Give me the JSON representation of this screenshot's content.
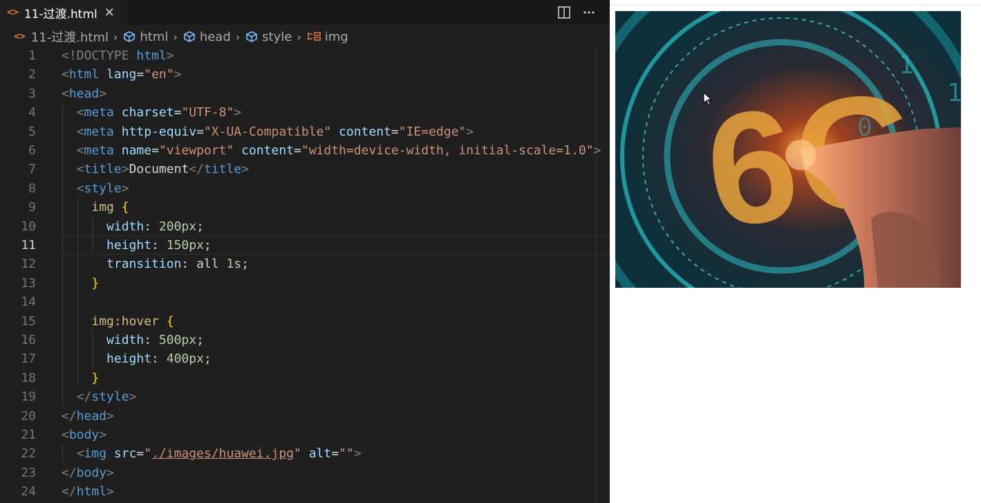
{
  "tab": {
    "icon": "<>",
    "title": "11-过渡.html",
    "close": "✕"
  },
  "breadcrumbs": [
    {
      "label": "11-过渡.html",
      "icon": "html-file-icon"
    },
    {
      "label": "html",
      "icon": "element-cube-icon"
    },
    {
      "label": "head",
      "icon": "element-cube-icon"
    },
    {
      "label": "style",
      "icon": "element-cube-icon"
    },
    {
      "label": "img",
      "icon": "css-rule-icon"
    }
  ],
  "code": {
    "active_line": 11,
    "lines": [
      {
        "n": "1",
        "t": [
          [
            "punc",
            "<!DOCTYPE "
          ],
          [
            "tag",
            "html"
          ],
          [
            "punc",
            ">"
          ]
        ]
      },
      {
        "n": "2",
        "t": [
          [
            "punc",
            "<"
          ],
          [
            "tag",
            "html"
          ],
          [
            "text",
            " "
          ],
          [
            "attr",
            "lang"
          ],
          [
            "text",
            "="
          ],
          [
            "str",
            "\"en\""
          ],
          [
            "punc",
            ">"
          ]
        ]
      },
      {
        "n": "3",
        "t": [
          [
            "punc",
            "<"
          ],
          [
            "tag",
            "head"
          ],
          [
            "punc",
            ">"
          ]
        ]
      },
      {
        "n": "4",
        "t": [
          [
            "text",
            "  "
          ],
          [
            "punc",
            "<"
          ],
          [
            "tag",
            "meta"
          ],
          [
            "text",
            " "
          ],
          [
            "attr",
            "charset"
          ],
          [
            "text",
            "="
          ],
          [
            "str",
            "\"UTF-8\""
          ],
          [
            "punc",
            ">"
          ]
        ]
      },
      {
        "n": "5",
        "t": [
          [
            "text",
            "  "
          ],
          [
            "punc",
            "<"
          ],
          [
            "tag",
            "meta"
          ],
          [
            "text",
            " "
          ],
          [
            "attr",
            "http-equiv"
          ],
          [
            "text",
            "="
          ],
          [
            "str",
            "\"X-UA-Compatible\""
          ],
          [
            "text",
            " "
          ],
          [
            "attr",
            "content"
          ],
          [
            "text",
            "="
          ],
          [
            "str",
            "\"IE=edge\""
          ],
          [
            "punc",
            ">"
          ]
        ]
      },
      {
        "n": "6",
        "t": [
          [
            "text",
            "  "
          ],
          [
            "punc",
            "<"
          ],
          [
            "tag",
            "meta"
          ],
          [
            "text",
            " "
          ],
          [
            "attr",
            "name"
          ],
          [
            "text",
            "="
          ],
          [
            "str",
            "\"viewport\""
          ],
          [
            "text",
            " "
          ],
          [
            "attr",
            "content"
          ],
          [
            "text",
            "="
          ],
          [
            "str",
            "\"width=device-width, initial-scale=1.0\""
          ],
          [
            "punc",
            ">"
          ]
        ]
      },
      {
        "n": "7",
        "t": [
          [
            "text",
            "  "
          ],
          [
            "punc",
            "<"
          ],
          [
            "tag",
            "title"
          ],
          [
            "punc",
            ">"
          ],
          [
            "text",
            "Document"
          ],
          [
            "punc",
            "</"
          ],
          [
            "tag",
            "title"
          ],
          [
            "punc",
            ">"
          ]
        ]
      },
      {
        "n": "8",
        "t": [
          [
            "text",
            "  "
          ],
          [
            "punc",
            "<"
          ],
          [
            "tag",
            "style"
          ],
          [
            "punc",
            ">"
          ]
        ]
      },
      {
        "n": "9",
        "t": [
          [
            "text",
            "    "
          ],
          [
            "sel",
            "img"
          ],
          [
            "text",
            " "
          ],
          [
            "brace",
            "{"
          ]
        ]
      },
      {
        "n": "10",
        "t": [
          [
            "text",
            "      "
          ],
          [
            "attr",
            "width"
          ],
          [
            "text",
            ": "
          ],
          [
            "num",
            "200px"
          ],
          [
            "text",
            ";"
          ]
        ]
      },
      {
        "n": "11",
        "t": [
          [
            "text",
            "      "
          ],
          [
            "attr",
            "height"
          ],
          [
            "text",
            ": "
          ],
          [
            "num",
            "150px"
          ],
          [
            "text",
            ";"
          ]
        ]
      },
      {
        "n": "12",
        "t": [
          [
            "text",
            "      "
          ],
          [
            "attr",
            "transition"
          ],
          [
            "text",
            ": all "
          ],
          [
            "num",
            "1s"
          ],
          [
            "text",
            ";"
          ]
        ]
      },
      {
        "n": "13",
        "t": [
          [
            "text",
            "    "
          ],
          [
            "brace",
            "}"
          ]
        ]
      },
      {
        "n": "14",
        "t": []
      },
      {
        "n": "15",
        "t": [
          [
            "text",
            "    "
          ],
          [
            "sel",
            "img:hover"
          ],
          [
            "text",
            " "
          ],
          [
            "brace",
            "{"
          ]
        ]
      },
      {
        "n": "16",
        "t": [
          [
            "text",
            "      "
          ],
          [
            "attr",
            "width"
          ],
          [
            "text",
            ": "
          ],
          [
            "num",
            "500px"
          ],
          [
            "text",
            ";"
          ]
        ]
      },
      {
        "n": "17",
        "t": [
          [
            "text",
            "      "
          ],
          [
            "attr",
            "height"
          ],
          [
            "text",
            ": "
          ],
          [
            "num",
            "400px"
          ],
          [
            "text",
            ";"
          ]
        ]
      },
      {
        "n": "18",
        "t": [
          [
            "text",
            "    "
          ],
          [
            "brace",
            "}"
          ]
        ]
      },
      {
        "n": "19",
        "t": [
          [
            "text",
            "  "
          ],
          [
            "punc",
            "</"
          ],
          [
            "tag",
            "style"
          ],
          [
            "punc",
            ">"
          ]
        ]
      },
      {
        "n": "20",
        "t": [
          [
            "punc",
            "</"
          ],
          [
            "tag",
            "head"
          ],
          [
            "punc",
            ">"
          ]
        ]
      },
      {
        "n": "21",
        "t": [
          [
            "punc",
            "<"
          ],
          [
            "tag",
            "body"
          ],
          [
            "punc",
            ">"
          ]
        ]
      },
      {
        "n": "22",
        "t": [
          [
            "text",
            "  "
          ],
          [
            "punc",
            "<"
          ],
          [
            "tag",
            "img"
          ],
          [
            "text",
            " "
          ],
          [
            "attr",
            "src"
          ],
          [
            "text",
            "="
          ],
          [
            "str",
            "\""
          ],
          [
            "link",
            "./images/huawei.jpg"
          ],
          [
            "str",
            "\""
          ],
          [
            "text",
            " "
          ],
          [
            "attr",
            "alt"
          ],
          [
            "text",
            "="
          ],
          [
            "str",
            "\"\""
          ],
          [
            "punc",
            ">"
          ]
        ]
      },
      {
        "n": "23",
        "t": [
          [
            "punc",
            "</"
          ],
          [
            "tag",
            "body"
          ],
          [
            "punc",
            ">"
          ]
        ]
      },
      {
        "n": "24",
        "t": [
          [
            "punc",
            "</"
          ],
          [
            "tag",
            "html"
          ],
          [
            "punc",
            ">"
          ]
        ]
      }
    ]
  },
  "preview": {
    "image_label": "6G"
  },
  "colors": {
    "editor_bg": "#1f1f1f",
    "tag": "#569cd6",
    "attr": "#9cdcfe",
    "string": "#ce9178",
    "selector": "#d7ba7d",
    "number": "#b5cea8"
  }
}
